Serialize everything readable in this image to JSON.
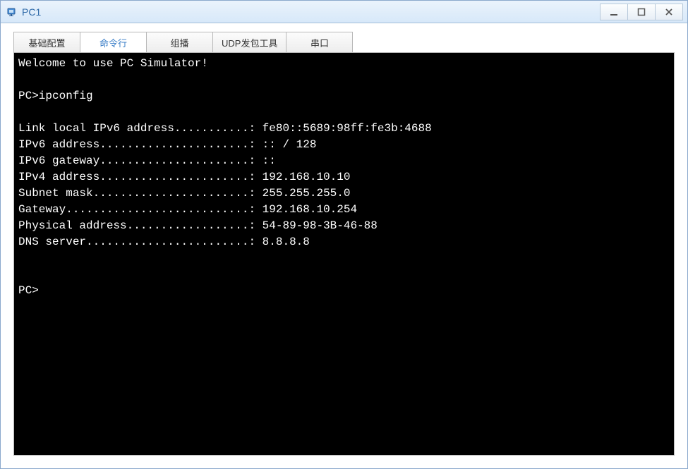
{
  "window": {
    "title": "PC1"
  },
  "tabs": {
    "items": [
      {
        "label": "基础配置"
      },
      {
        "label": "命令行"
      },
      {
        "label": "组播"
      },
      {
        "label": "UDP发包工具"
      },
      {
        "label": "串口"
      }
    ]
  },
  "terminal": {
    "welcome": "Welcome to use PC Simulator!",
    "prompt1": "PC>ipconfig",
    "line_link_local": "Link local IPv6 address...........: fe80::5689:98ff:fe3b:4688",
    "line_ipv6_addr": "IPv6 address......................: :: / 128",
    "line_ipv6_gw": "IPv6 gateway......................: ::",
    "line_ipv4_addr": "IPv4 address......................: 192.168.10.10",
    "line_subnet": "Subnet mask.......................: 255.255.255.0",
    "line_gateway": "Gateway...........................: 192.168.10.254",
    "line_physical": "Physical address..................: 54-89-98-3B-46-88",
    "line_dns": "DNS server........................: 8.8.8.8",
    "prompt2": "PC>"
  }
}
